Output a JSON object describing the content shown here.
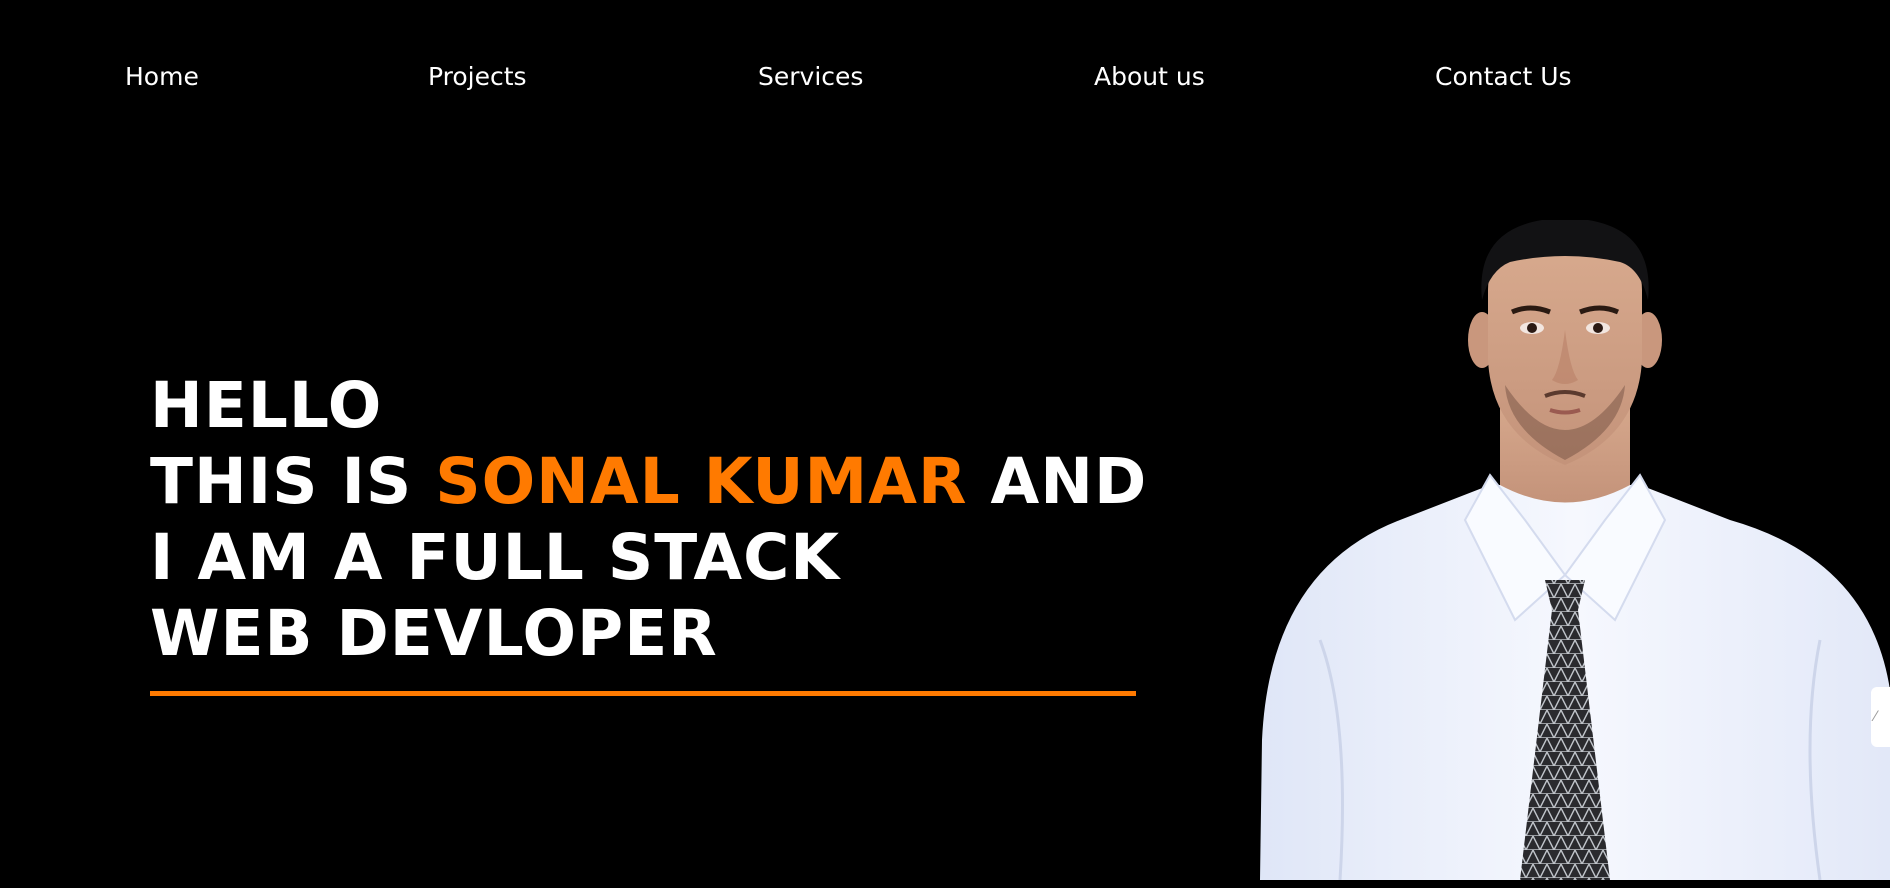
{
  "nav": {
    "items": [
      {
        "label": "Home"
      },
      {
        "label": "Projects"
      },
      {
        "label": "Services"
      },
      {
        "label": "About us"
      },
      {
        "label": "Contact Us"
      }
    ]
  },
  "hero": {
    "greeting": "HELLO",
    "line2_prefix": "THIS IS ",
    "name": "SONAL KUMAR",
    "line2_suffix": " AND",
    "line3": "I AM A FULL STACK",
    "line4": "WEB DEVLOPER"
  },
  "colors": {
    "accent": "#ff7a00",
    "background": "#000000",
    "text": "#ffffff"
  },
  "portrait": {
    "icon": "person-portrait-photo"
  }
}
